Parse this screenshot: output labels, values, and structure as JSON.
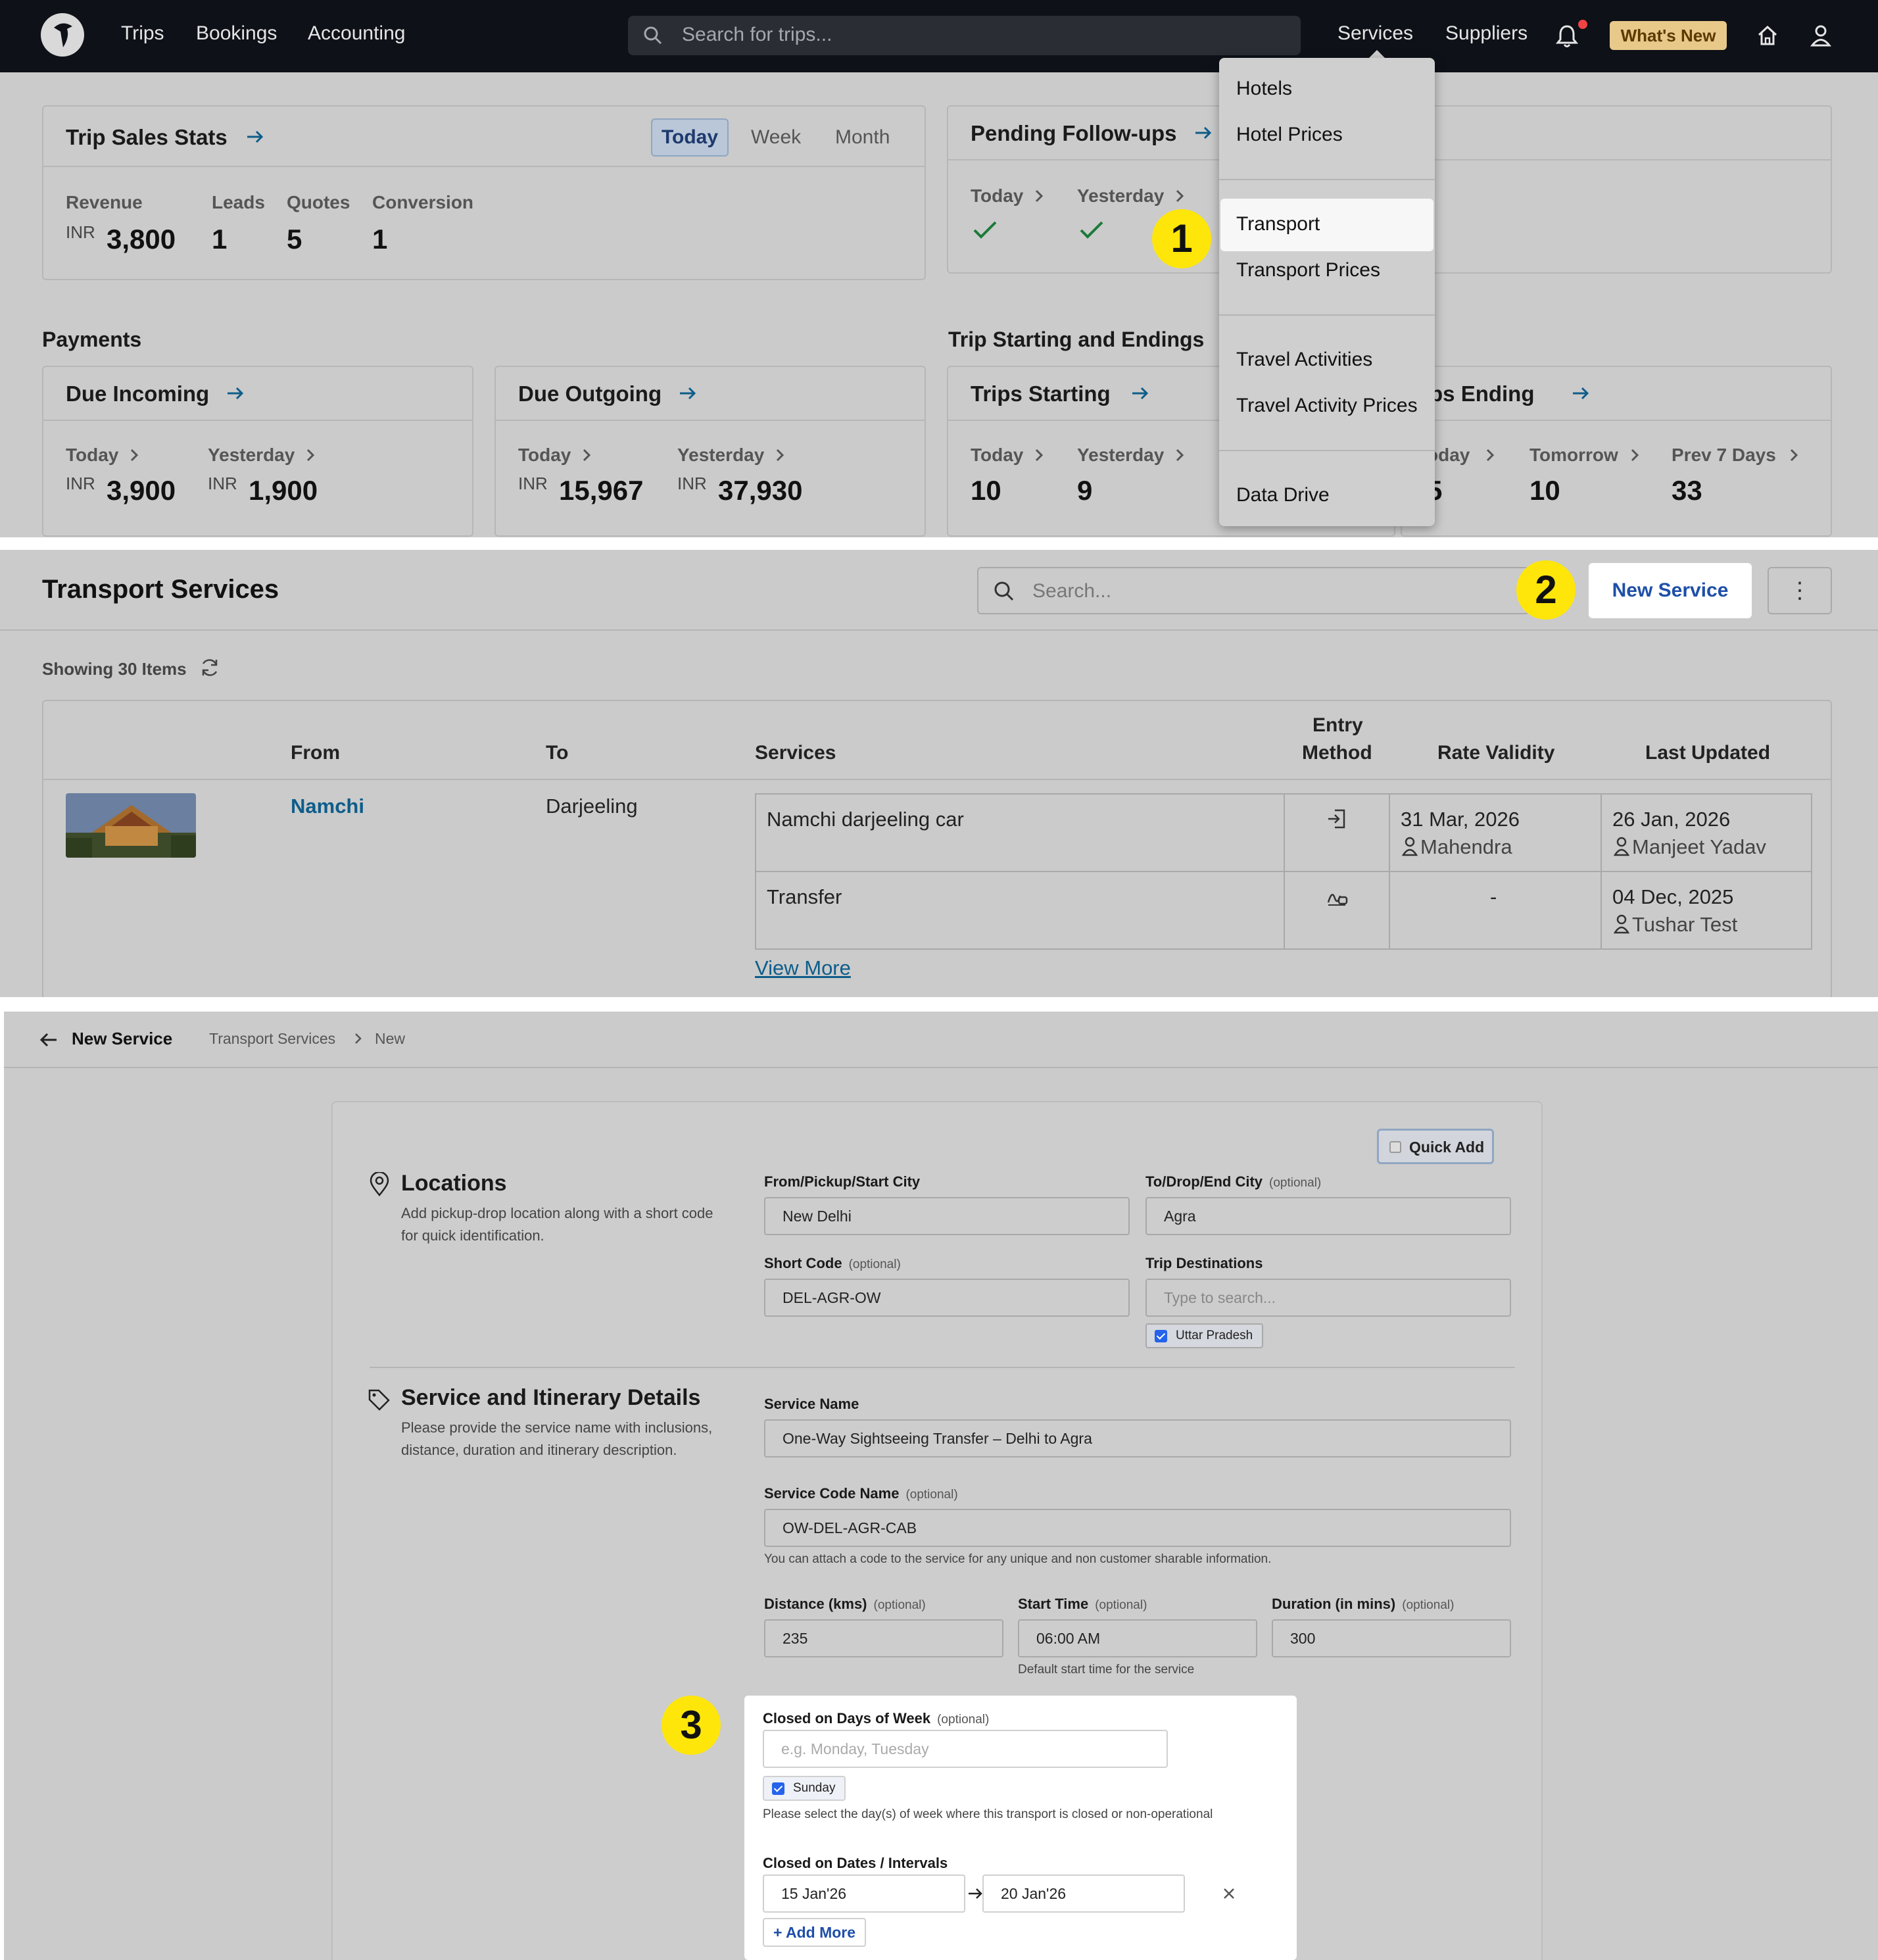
{
  "topbar": {
    "nav": [
      "Trips",
      "Bookings",
      "Accounting"
    ],
    "search_placeholder": "Search for trips...",
    "right_nav": [
      "Services",
      "Suppliers"
    ],
    "whats_new": "What's New"
  },
  "services_menu": {
    "items": [
      "Hotels",
      "Hotel Prices",
      "Transport",
      "Transport Prices",
      "Travel Activities",
      "Travel Activity Prices",
      "Data Drive"
    ],
    "highlighted": "Transport"
  },
  "trip_sales": {
    "title": "Trip Sales Stats",
    "tabs": [
      "Today",
      "Week",
      "Month"
    ],
    "selected_tab": "Today",
    "stats": [
      {
        "label": "Revenue",
        "prefix": "INR",
        "value": "3,800"
      },
      {
        "label": "Leads",
        "value": "1"
      },
      {
        "label": "Quotes",
        "value": "5"
      },
      {
        "label": "Conversion",
        "value": "1"
      }
    ]
  },
  "pending": {
    "title": "Pending Follow-ups",
    "cols": [
      "Today",
      "Yesterday"
    ]
  },
  "payments": {
    "section": "Payments",
    "due_incoming": {
      "title": "Due Incoming",
      "today_label": "Today",
      "yesterday_label": "Yesterday",
      "today_prefix": "INR",
      "today": "3,900",
      "yesterday_prefix": "INR",
      "yesterday": "1,900"
    },
    "due_outgoing": {
      "title": "Due Outgoing",
      "today_label": "Today",
      "yesterday_label": "Yesterday",
      "today_prefix": "INR",
      "today": "15,967",
      "yesterday_prefix": "INR",
      "yesterday": "37,930"
    }
  },
  "trip_start_end": {
    "section": "Trip Starting and Endings",
    "starting": {
      "title": "Trips Starting",
      "today_label": "Today",
      "yesterday_label": "Yesterday",
      "today": "10",
      "yesterday": "9"
    },
    "ending": {
      "title": "rips Ending",
      "c1_label": "oday",
      "c1": "5",
      "c2_label": "Tomorrow",
      "c2": "10",
      "c3_label": "Prev 7 Days",
      "c3": "33"
    }
  },
  "badges": [
    "1",
    "2",
    "3"
  ],
  "transport": {
    "title": "Transport Services",
    "search_placeholder": "Search...",
    "new_service": "New Service",
    "kebab": "⋮",
    "showing": "Showing 30 Items",
    "headers": [
      "From",
      "To",
      "Services",
      "Entry",
      "Method",
      "Rate Validity",
      "Last Updated"
    ],
    "row": {
      "from": "Namchi",
      "to": "Darjeeling",
      "services": [
        {
          "name": "Namchi darjeeling car",
          "validity": "31 Mar, 2026",
          "validity_by": "Mahendra",
          "updated": "26 Jan, 2026",
          "updated_by": "Manjeet Yadav"
        },
        {
          "name": "Transfer",
          "validity": "-",
          "updated": "04 Dec, 2025",
          "updated_by": "Tushar Test"
        }
      ],
      "view_more": "View More"
    }
  },
  "new_service": {
    "back_title": "New Service",
    "breadcrumb": [
      "Transport Services",
      "New"
    ],
    "quick_add": "Quick Add",
    "locations": {
      "title": "Locations",
      "desc_line1": "Add pickup-drop location along with a short code",
      "desc_line2": "for quick identification.",
      "from_label": "From/Pickup/Start City",
      "from_value": "New Delhi",
      "to_label": "To/Drop/End City",
      "to_value": "Agra",
      "short_label": "Short Code",
      "short_value": "DEL-AGR-OW",
      "dest_label": "Trip Destinations",
      "dest_placeholder": "Type to search...",
      "dest_chip": "Uttar Pradesh",
      "optional": "(optional)"
    },
    "service": {
      "title": "Service and Itinerary Details",
      "desc_line1": "Please provide the service name with inclusions,",
      "desc_line2": "distance, duration and itinerary description.",
      "name_label": "Service Name",
      "name_value": "One-Way Sightseeing Transfer – Delhi to Agra",
      "code_label": "Service Code Name",
      "code_value": "OW-DEL-AGR-CAB",
      "code_hint": "You can attach a code to the service for any unique and non customer sharable information.",
      "distance_label": "Distance (kms)",
      "distance_value": "235",
      "start_label": "Start Time",
      "start_value": "06:00 AM",
      "start_hint": "Default start time for the service",
      "duration_label": "Duration (in mins)",
      "duration_value": "300",
      "closed_days_label": "Closed on Days of Week",
      "closed_days_placeholder": "e.g. Monday, Tuesday",
      "closed_days_chip": "Sunday",
      "closed_days_hint": "Please select the day(s) of week where this transport is closed or non-operational",
      "closed_dates_label": "Closed on Dates / Intervals",
      "date_from": "15 Jan'26",
      "date_to": "20 Jan'26",
      "add_more": "+ Add More"
    }
  },
  "colors": {
    "accent": "#0e5d8a",
    "badge": "#ffe60a",
    "brand_blue": "#1e4fa8",
    "topbar": "#0e1117"
  }
}
